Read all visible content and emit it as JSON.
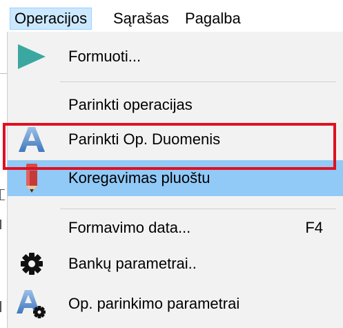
{
  "menubar": {
    "items": [
      {
        "label": "Operacijos",
        "active": true
      },
      {
        "label": "Sąrašas",
        "active": false
      },
      {
        "label": "Pagalba",
        "active": false
      }
    ]
  },
  "dropdown": {
    "items": [
      {
        "label": "Formuoti...",
        "icon": "play-icon",
        "shortcut": ""
      },
      {
        "label": "Parinkti operacijas",
        "icon": "",
        "shortcut": ""
      },
      {
        "label": "Parinkti Op. Duomenis",
        "icon": "letter-a-icon",
        "shortcut": ""
      },
      {
        "label": "Koregavimas pluoštu",
        "icon": "pencil-icon",
        "shortcut": "",
        "highlighted": true
      },
      {
        "label": "Formavimo data...",
        "icon": "",
        "shortcut": "F4"
      },
      {
        "label": "Bankų parametrai..",
        "icon": "gear-icon",
        "shortcut": ""
      },
      {
        "label": "Op. parinkimo parametrai",
        "icon": "letter-a-gear-icon",
        "shortcut": ""
      }
    ]
  },
  "colors": {
    "menu_background": "#f2f2f2",
    "highlight": "#91c9f7",
    "highlight_border": "#e01020",
    "menubar_active": "#cce8ff",
    "play_icon": "#3aa8a0",
    "letter_icon": "#4a86c8"
  }
}
